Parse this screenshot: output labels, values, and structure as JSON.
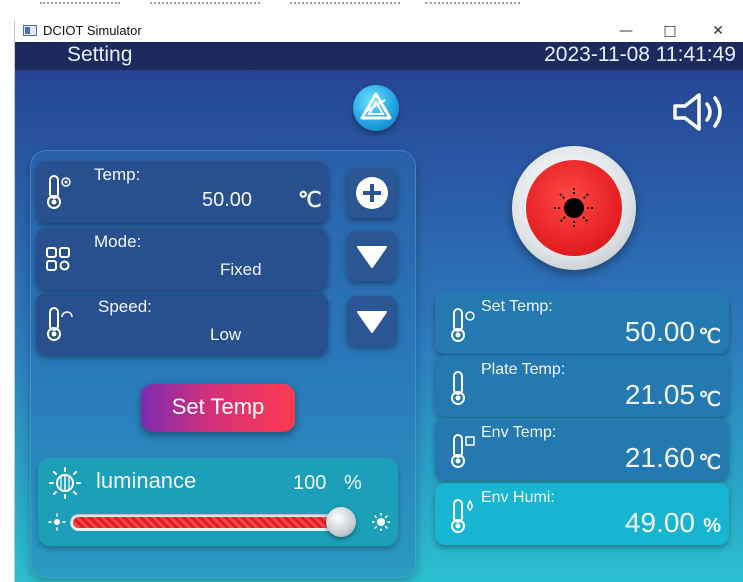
{
  "window": {
    "title": "DCIOT Simulator",
    "controls": {
      "minimize": "—",
      "maximize": "□",
      "close": "✕"
    }
  },
  "header": {
    "title": "Setting",
    "datetime": "2023-11-08 11:41:49"
  },
  "icons": {
    "logo": "logo-icon",
    "speaker": "speaker-icon",
    "alarm": "alarm-light-icon"
  },
  "controls": {
    "temp": {
      "label": "Temp:",
      "value": "50.00",
      "unit": "℃",
      "action": "plus"
    },
    "mode": {
      "label": "Mode:",
      "value": "Fixed",
      "action": "dropdown"
    },
    "speed": {
      "label": "Speed:",
      "value": "Low",
      "action": "dropdown"
    },
    "set_button": "Set Temp"
  },
  "luminance": {
    "label": "luminance",
    "value": "100",
    "unit": "%",
    "level": 1.0
  },
  "readings": [
    {
      "label": "Set Temp:",
      "value": "50.00",
      "unit": "℃"
    },
    {
      "label": "Plate Temp:",
      "value": "21.05",
      "unit": "℃"
    },
    {
      "label": "Env Temp:",
      "value": "21.60",
      "unit": "℃"
    },
    {
      "label": "Env Humi:",
      "value": "49.00",
      "unit": "%"
    }
  ],
  "colors": {
    "header": "#1c2a5e",
    "accent_red": "#e31c1f",
    "panel": "#28508f",
    "set_button_start": "#7a2bb0",
    "set_button_end": "#ff3a4f"
  }
}
